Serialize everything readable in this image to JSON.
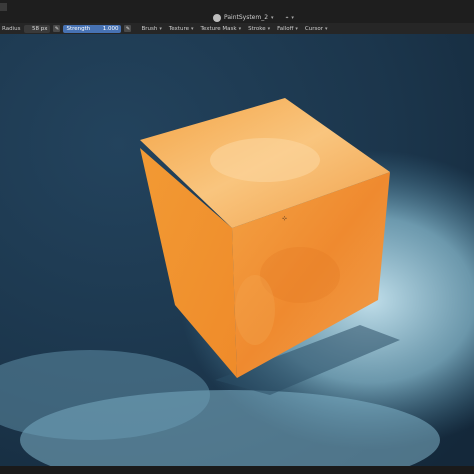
{
  "header": {
    "scene_name": "PaintSystem_2",
    "scene_icon": "blender-icon",
    "extra_icon": "pin-icon"
  },
  "toolbar": {
    "radius_label": "Radius",
    "radius_value": "58 px",
    "strength_label": "Strength",
    "strength_value": "1.000",
    "menus": [
      "Brush",
      "Texture",
      "Texture Mask",
      "Stroke",
      "Falloff",
      "Cursor"
    ]
  },
  "colors": {
    "accent": "#4772b3",
    "background": "#1d3a52",
    "cube_front": "#f08a2a",
    "cube_top": "#f8c27a"
  }
}
